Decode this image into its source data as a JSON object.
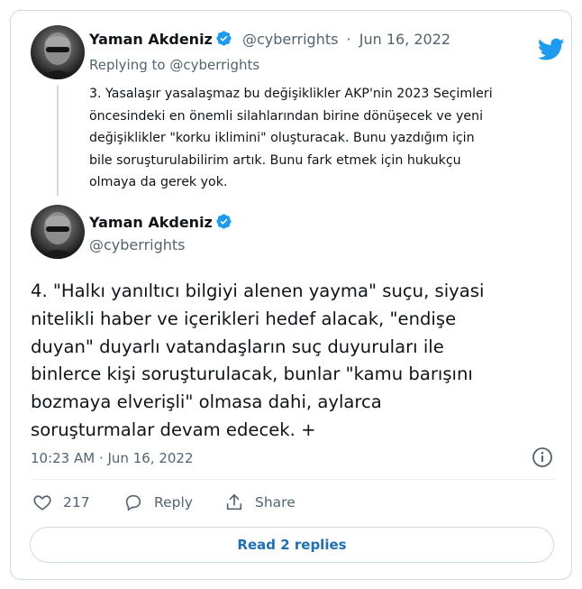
{
  "reply_tweet": {
    "author_name": "Yaman Akdeniz",
    "handle": "@cyberrights",
    "separator": "·",
    "date": "Jun 16, 2022",
    "replying_to_prefix": "Replying to",
    "replying_to_handle": "@cyberrights",
    "text_lines": [
      "3. Yasalaşır yasalaşmaz bu değişiklikler AKP'nin 2023 Seçimleri",
      "öncesindeki en önemli silahlarından birine dönüşecek ve yeni",
      "değişiklikler \"korku iklimini\" oluşturacak. Bunu yazdığım için",
      "bile soruşturulabilirim artık. Bunu fark etmek için hukukçu",
      "olmaya da gerek yok."
    ]
  },
  "main_tweet": {
    "author_name": "Yaman Akdeniz",
    "handle": "@cyberrights",
    "text_lines": [
      "4. \"Halkı yanıltıcı bilgiyi alenen yayma\" suçu, siyasi",
      "nitelikli haber ve içerikleri hedef alacak, \"endişe",
      "duyan\" duyarlı vatandaşların suç duyuruları ile",
      "binlerce kişi soruşturulacak, bunlar \"kamu barışını",
      "bozmaya elverişli\" olmasa dahi, aylarca",
      "soruşturmalar devam edecek. +"
    ],
    "timestamp": "10:23 AM · Jun 16, 2022"
  },
  "actions": {
    "like_count": "217",
    "reply_label": "Reply",
    "share_label": "Share"
  },
  "read_replies_label": "Read 2 replies",
  "colors": {
    "twitter_blue": "#1d9bf0",
    "verified_blue": "#1d9bf0",
    "muted_text": "#536471",
    "border": "#cfd9de",
    "link_blue": "#1d6fb8"
  }
}
